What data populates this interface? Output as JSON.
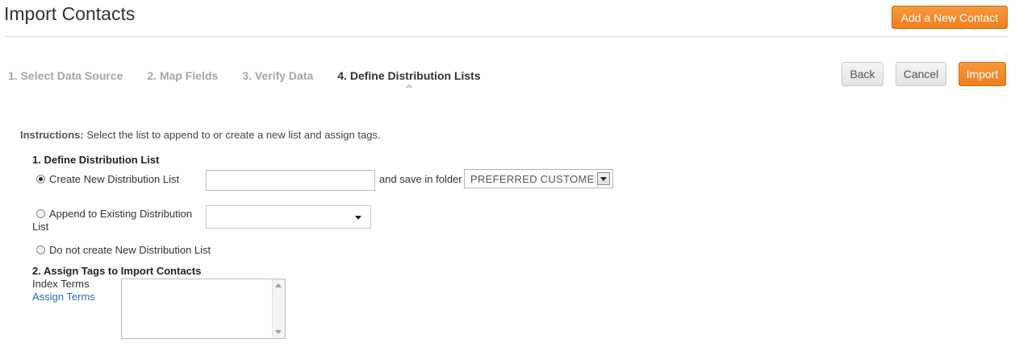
{
  "header": {
    "title": "Import Contacts",
    "add_contact_label": "Add a New Contact"
  },
  "wizard": {
    "steps": [
      {
        "label": "1. Select Data Source"
      },
      {
        "label": "2. Map Fields"
      },
      {
        "label": "3. Verify Data"
      },
      {
        "label": "4. Define Distribution Lists"
      }
    ],
    "active_step": 4,
    "back_label": "Back",
    "cancel_label": "Cancel",
    "import_label": "Import"
  },
  "instructions": {
    "label": "Instructions:",
    "text": " Select the list to append to or create a new list and assign tags."
  },
  "section1": {
    "title": "1. Define Distribution List",
    "option_create": "Create New Distribution List",
    "option_append_line1": "Append to Existing Distribution",
    "option_append_line2": "List",
    "option_none": "Do not create New Distribution List",
    "selected_option": "create",
    "list_name_value": "",
    "save_in_folder_label": "and save in folder",
    "folder_value": "PREFERRED CUSTOMERS",
    "existing_list_value": ""
  },
  "section2": {
    "title": "2. Assign Tags to Import Contacts",
    "index_terms_label": "Index Terms",
    "assign_terms_link": "Assign Terms",
    "terms_value": ""
  },
  "colors": {
    "accent_orange": "#ef7f1c",
    "link_blue": "#2a6bb5",
    "inactive_step": "#a6a6a6"
  }
}
